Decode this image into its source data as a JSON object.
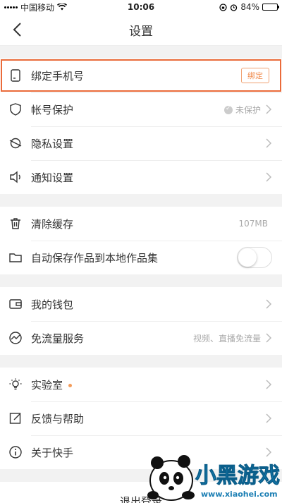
{
  "status_bar": {
    "carrier": "中国移动",
    "time": "10:06",
    "battery": "84%",
    "battery_level": 0.84
  },
  "nav": {
    "title": "设置"
  },
  "sections": {
    "account": {
      "bind_phone": {
        "label": "绑定手机号",
        "button": "绑定"
      },
      "account_protect": {
        "label": "帐号保护",
        "value": "未保护"
      },
      "privacy": {
        "label": "隐私设置"
      },
      "notify": {
        "label": "通知设置"
      }
    },
    "storage": {
      "clear_cache": {
        "label": "清除缓存",
        "value": "107MB"
      },
      "auto_save": {
        "label": "自动保存作品到本地作品集",
        "enabled": false
      }
    },
    "wallet": {
      "my_wallet": {
        "label": "我的钱包"
      },
      "free_traffic": {
        "label": "免流量服务",
        "value": "视频、直播免流量"
      }
    },
    "misc": {
      "lab": {
        "label": "实验室"
      },
      "feedback": {
        "label": "反馈与帮助"
      },
      "about": {
        "label": "关于快手"
      }
    }
  },
  "logout": {
    "label": "退出登录"
  },
  "watermark": {
    "brand": "小黑游戏",
    "url": "www.xiaohei.com"
  },
  "colors": {
    "highlight": "#ea6b3a",
    "accent": "#f08a4b"
  }
}
